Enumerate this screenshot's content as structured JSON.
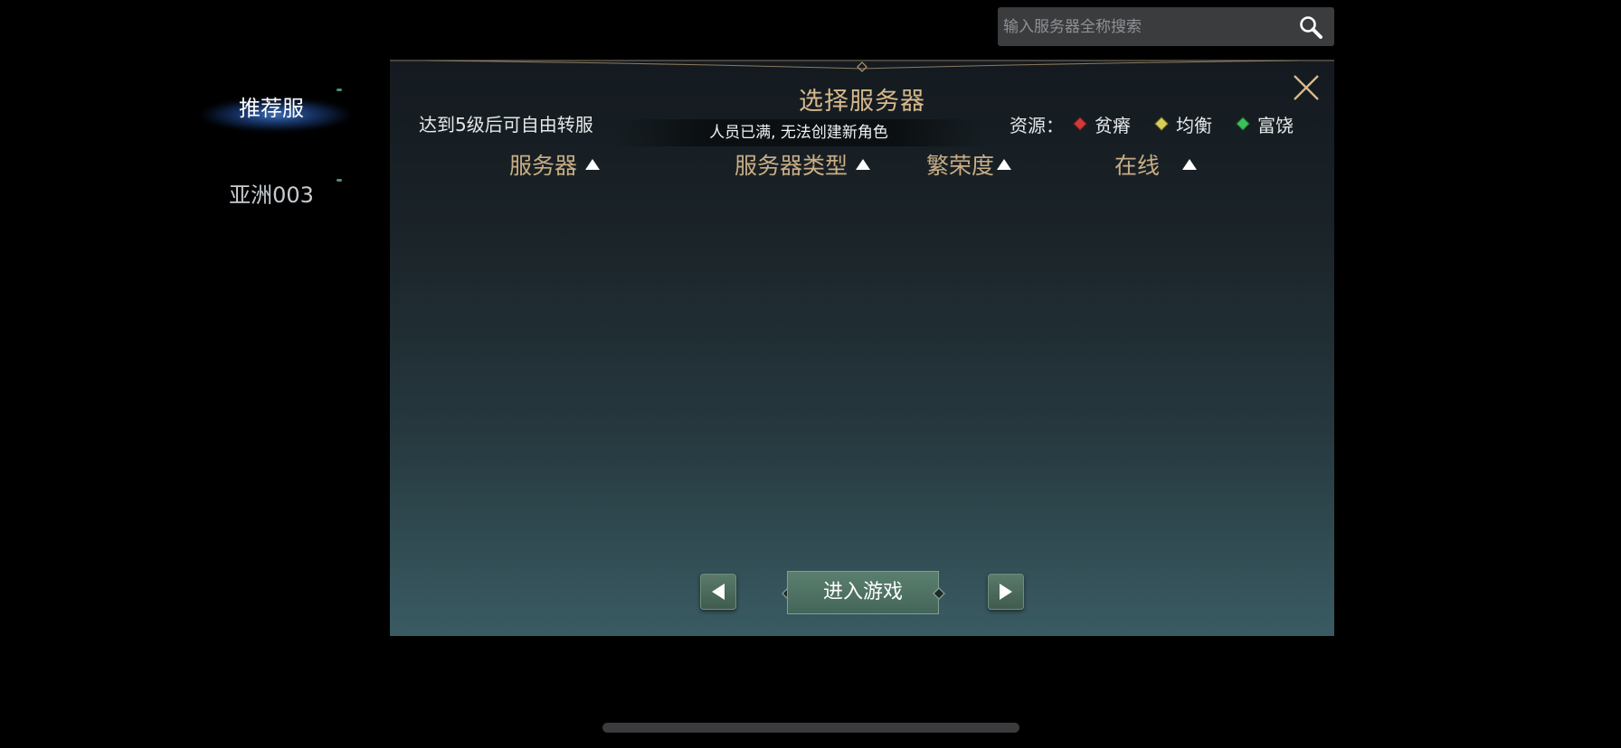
{
  "search": {
    "placeholder": "输入服务器全称搜索"
  },
  "sidebar": {
    "items": [
      {
        "label": "推荐服"
      },
      {
        "label": "亚洲003"
      }
    ]
  },
  "panel": {
    "title": "选择服务器",
    "transfer_hint": "达到5级后可自由转服",
    "status_banner": "人员已满, 无法创建新角色",
    "resource_label": "资源：",
    "resources": [
      {
        "label": "贫瘠",
        "color": "#d23a3a"
      },
      {
        "label": "均衡",
        "color": "#d8cf5a"
      },
      {
        "label": "富饶",
        "color": "#3fbf5a"
      }
    ],
    "columns": [
      {
        "label": "服务器"
      },
      {
        "label": "服务器类型"
      },
      {
        "label": "繁荣度"
      },
      {
        "label": "在线"
      }
    ],
    "enter_game_label": "进入游戏"
  },
  "colors": {
    "title": "#d6b98c",
    "header": "#c9ad85",
    "button": "#4f7263"
  },
  "icons": {
    "search": "search-icon",
    "close": "close-icon",
    "prev": "arrow-left-icon",
    "next": "arrow-right-icon",
    "sort": "sort-up-icon"
  }
}
